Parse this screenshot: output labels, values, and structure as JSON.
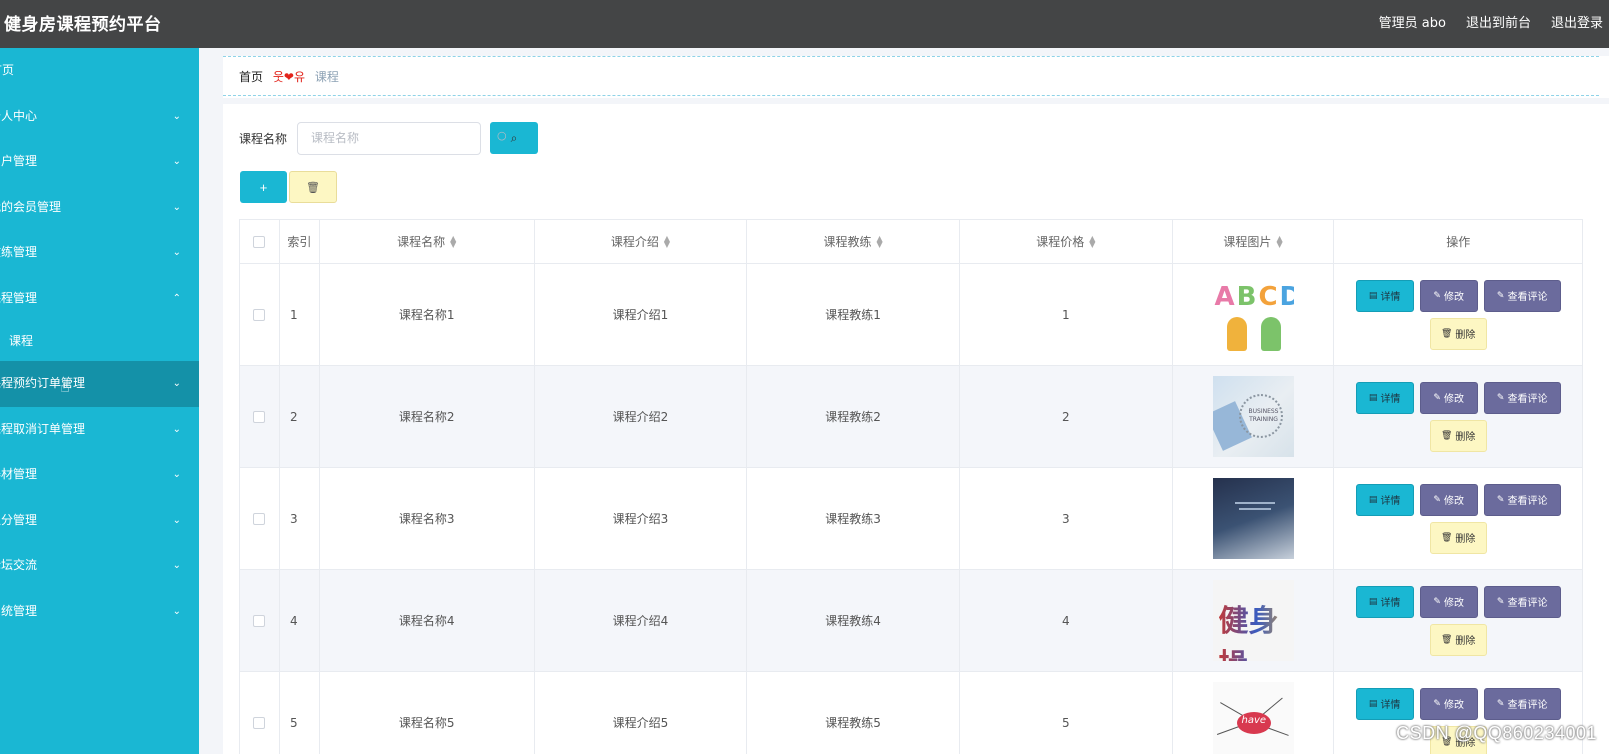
{
  "header": {
    "title": "健身房课程预约平台",
    "admin": "管理员 abo",
    "back_front": "退出到前台",
    "logout": "退出登录"
  },
  "sidebar": {
    "items": [
      {
        "label": "首页",
        "chevron": ""
      },
      {
        "label": "个人中心",
        "chevron": "⌄"
      },
      {
        "label": "用户管理",
        "chevron": "⌄"
      },
      {
        "label": "我的会员管理",
        "chevron": "⌄"
      },
      {
        "label": "教练管理",
        "chevron": "⌄"
      },
      {
        "label": "课程管理",
        "chevron": "⌃"
      },
      {
        "label": "课程",
        "chevron": ""
      },
      {
        "label": "课程预约订单管理",
        "chevron": "⌄"
      },
      {
        "label": "课程取消订单管理",
        "chevron": "⌄"
      },
      {
        "label": "器材管理",
        "chevron": "⌄"
      },
      {
        "label": "积分管理",
        "chevron": "⌄"
      },
      {
        "label": "论坛交流",
        "chevron": "⌄"
      },
      {
        "label": "系统管理",
        "chevron": "⌄"
      }
    ]
  },
  "breadcrumb": {
    "home": "首页",
    "separator": "웃❤유",
    "current": "课程"
  },
  "search": {
    "label": "课程名称",
    "placeholder": "课程名称",
    "button_icon": "search-icon"
  },
  "actions": {
    "add_label": "+",
    "delete_icon": "trash-icon"
  },
  "table": {
    "headers": {
      "index": "索引",
      "name": "课程名称",
      "intro": "课程介绍",
      "coach": "课程教练",
      "price": "课程价格",
      "image": "课程图片",
      "ops": "操作"
    },
    "rows": [
      {
        "index": "1",
        "name": "课程名称1",
        "intro": "课程介绍1",
        "coach": "课程教练1",
        "price": "1"
      },
      {
        "index": "2",
        "name": "课程名称2",
        "intro": "课程介绍2",
        "coach": "课程教练2",
        "price": "2"
      },
      {
        "index": "3",
        "name": "课程名称3",
        "intro": "课程介绍3",
        "coach": "课程教练3",
        "price": "3"
      },
      {
        "index": "4",
        "name": "课程名称4",
        "intro": "课程介绍4",
        "coach": "课程教练4",
        "price": "4"
      },
      {
        "index": "5",
        "name": "课程名称5",
        "intro": "课程介绍5",
        "coach": "课程教练5",
        "price": "5"
      }
    ],
    "op_labels": {
      "detail": "详情",
      "edit": "修改",
      "comment": "查看评论",
      "remove": "删除"
    }
  },
  "image_text": {
    "thumb1": "ABCD",
    "thumb2": "BUSINESS TRAINING",
    "thumb4": "健身操",
    "thumb5": "have"
  },
  "watermark": "CSDN @QQ860234001",
  "colors": {
    "header_bg": "#444546",
    "sidebar_bg": "#1ab7d3",
    "sidebar_active": "#1491a8",
    "primary": "#1ab7d3",
    "edit_btn": "#6b6b9d",
    "delete_btn": "#fdf7c3"
  }
}
